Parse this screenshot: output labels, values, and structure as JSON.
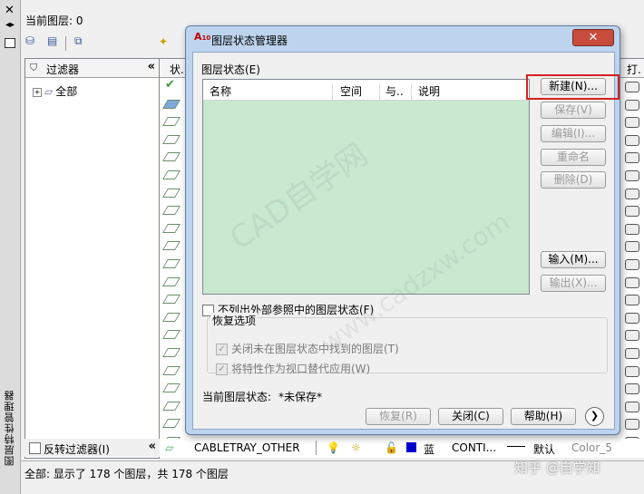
{
  "layer_manager": {
    "vertical_title": "图层特性管理器",
    "current_layer": "当前图层: 0",
    "filters_header": "过滤器",
    "tree_item": "全部",
    "invert_filter": "反转过滤器(I)",
    "col_status": "状..",
    "col_print": "打.",
    "status_bar": "全部: 显示了 178 个图层，共 178 个图层",
    "last_row": {
      "name": "CABLETRAY_OTHER",
      "color": "蓝",
      "linetype": "CONTI...",
      "lineweight": "默认",
      "plot_style": "Color_5"
    }
  },
  "dialog": {
    "title": "图层状态管理器",
    "states_label": "图层状态(E)",
    "columns": [
      "名称",
      "空间",
      "与..",
      "说明"
    ],
    "buttons": {
      "new": "新建(N)...",
      "save": "保存(V)",
      "edit": "编辑(I)...",
      "rename": "重命名",
      "delete": "删除(D)",
      "import": "输入(M)...",
      "export": "输出(X)..."
    },
    "no_xref": "不列出外部参照中的图层状态(F)",
    "restore_options": "恢复选项",
    "opt_turn_off": "关闭未在图层状态中找到的图层(T)",
    "opt_viewport": "将特性作为视口替代应用(W)",
    "current_state_label": "当前图层状态:",
    "current_state_value": "*未保存*",
    "bottom": {
      "restore": "恢复(R)",
      "close": "关闭(C)",
      "help": "帮助(H)"
    }
  },
  "watermark": {
    "line1": "CAD自学网",
    "line2": "www.cadzxw.com",
    "credit": "知乎 @自学知"
  },
  "colors": {
    "highlight": "#d42020",
    "list_bg": "#c8e8d0",
    "dialog_frame": "#bcd4ee"
  }
}
